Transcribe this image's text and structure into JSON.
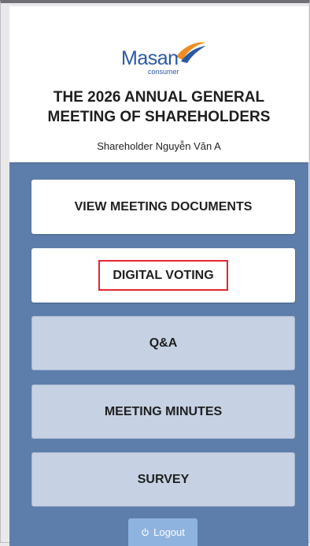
{
  "brand": {
    "name": "Masan",
    "sub": "consumer",
    "primary_color": "#2a58a5",
    "accent_color": "#f28c1e"
  },
  "header": {
    "title_line1": "THE 2026 ANNUAL GENERAL",
    "title_line2": "MEETING OF SHAREHOLDERS",
    "shareholder": "Shareholder Nguyễn Văn A"
  },
  "menu": {
    "documents": "VIEW MEETING DOCUMENTS",
    "voting": "DIGITAL VOTING",
    "qa": "Q&A",
    "minutes": "MEETING MINUTES",
    "survey": "SURVEY"
  },
  "logout": {
    "label": "Logout",
    "icon": "power-icon"
  },
  "colors": {
    "background": "#5d7eab",
    "secondary_button": "#c6d1e3",
    "highlight_border": "#e3262f",
    "logout_button": "#8eb3df"
  }
}
